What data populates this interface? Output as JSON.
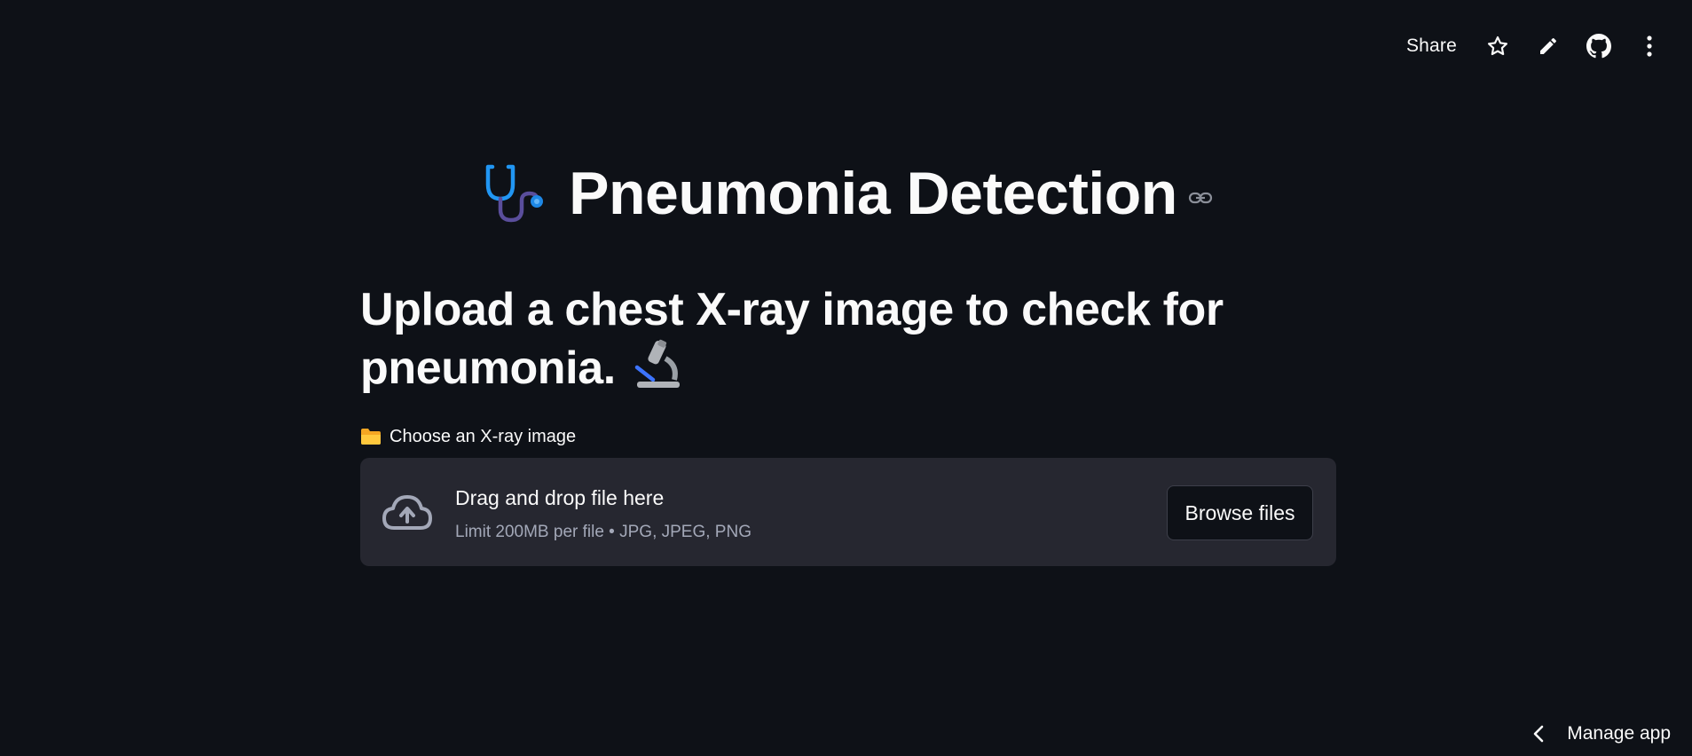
{
  "toolbar": {
    "share_label": "Share",
    "icons": [
      "star-icon",
      "pencil-icon",
      "github-icon",
      "kebab-menu-icon"
    ]
  },
  "header": {
    "title": "Pneumonia Detection",
    "title_icon": "stethoscope-icon"
  },
  "main": {
    "subheading": "Upload a chest X-ray image to check for pneumonia.",
    "subheading_icon": "microscope-icon",
    "uploader": {
      "label": "Choose an X-ray image",
      "label_icon": "folder-icon",
      "drop_title": "Drag and drop file here",
      "drop_subtitle": "Limit 200MB per file • JPG, JPEG, PNG",
      "browse_label": "Browse files"
    }
  },
  "footer": {
    "manage_label": "Manage app"
  },
  "colors": {
    "background": "#0e1117",
    "dropzone": "#262730",
    "text": "#fafafa",
    "muted_text": "#a3a8b8"
  }
}
